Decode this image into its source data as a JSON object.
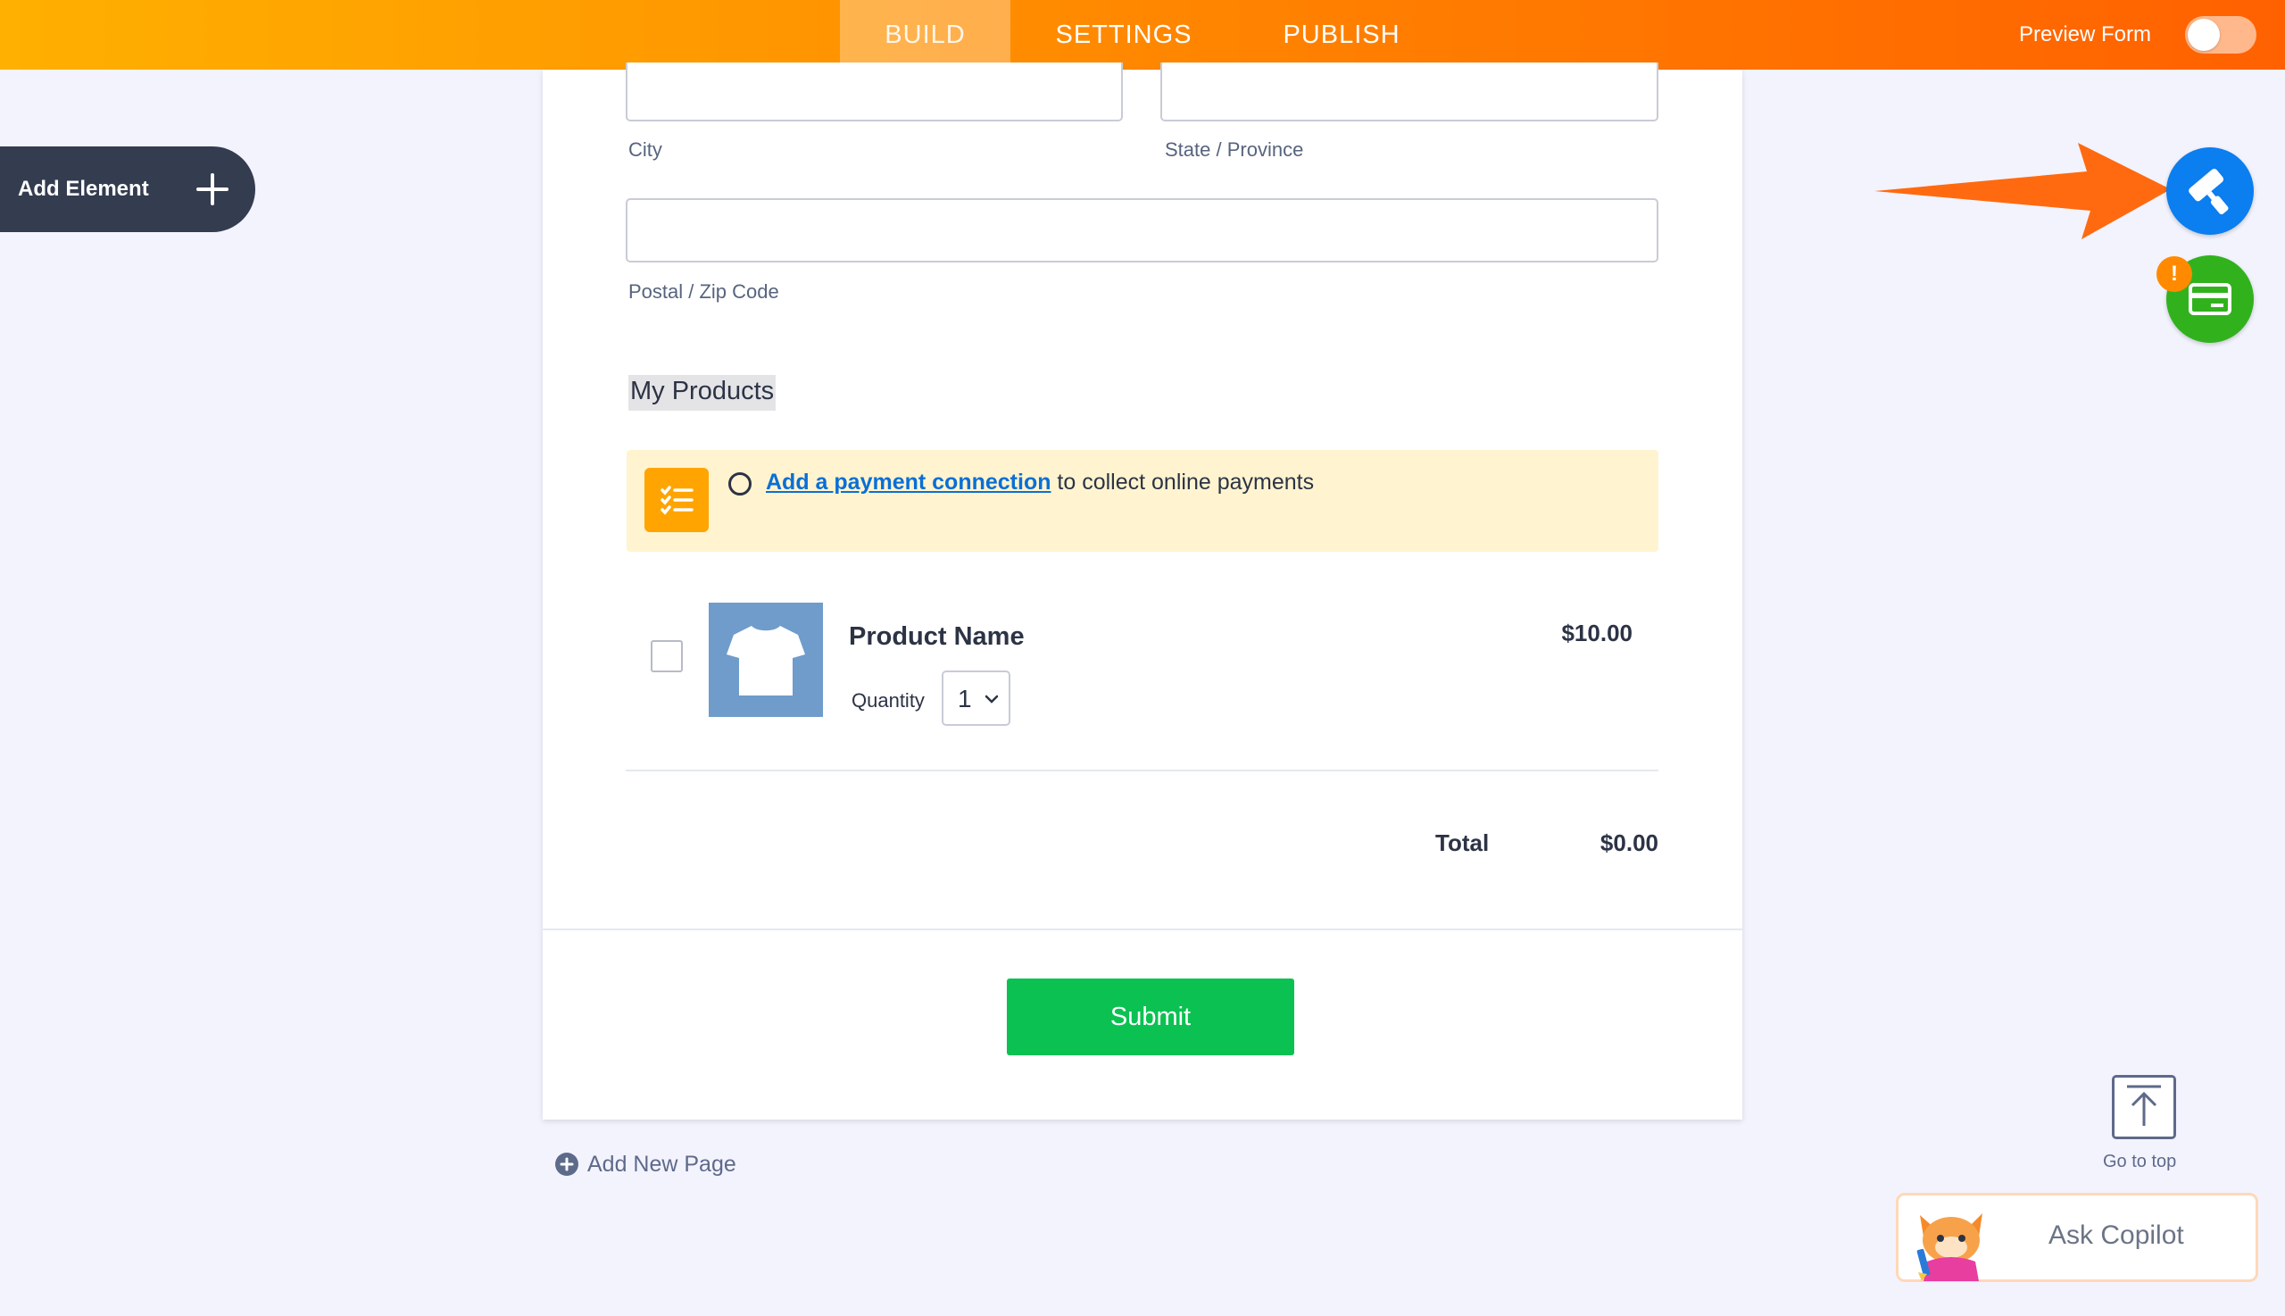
{
  "topbar": {
    "tabs": [
      {
        "label": "BUILD",
        "active": true
      },
      {
        "label": "SETTINGS",
        "active": false
      },
      {
        "label": "PUBLISH",
        "active": false
      }
    ],
    "preview_label": "Preview Form",
    "preview_enabled": false
  },
  "sidebar": {
    "add_element_label": "Add Element"
  },
  "form": {
    "fields": {
      "city_label": "City",
      "state_label": "State / Province",
      "postal_label": "Postal / Zip Code"
    },
    "section_heading": "My Products",
    "payment_banner": {
      "link_text": "Add a payment connection",
      "rest_text": " to collect online payments"
    },
    "product": {
      "name": "Product Name",
      "price": "$10.00",
      "quantity_label": "Quantity",
      "quantity_value": "1",
      "checked": false
    },
    "total_label": "Total",
    "total_value": "$0.00",
    "submit_label": "Submit"
  },
  "add_page_label": "Add New Page",
  "right_tools": {
    "warning_badge": "!"
  },
  "go_to_top_label": "Go to top",
  "copilot_label": "Ask Copilot",
  "colors": {
    "accent_orange": "#ff7e00",
    "submit_green": "#0bc152",
    "design_blue": "#0b7ef0",
    "payment_green": "#31b21d",
    "banner_yellow": "#fff4cf",
    "link_blue": "#0a6fd6"
  },
  "icons": {
    "add_element": "plus-icon",
    "banner": "checklist-icon",
    "design": "paint-roller-icon",
    "payment": "credit-card-icon",
    "go_top": "arrow-up-icon",
    "copilot": "copilot-avatar-icon",
    "add_page": "plus-circle-icon"
  }
}
